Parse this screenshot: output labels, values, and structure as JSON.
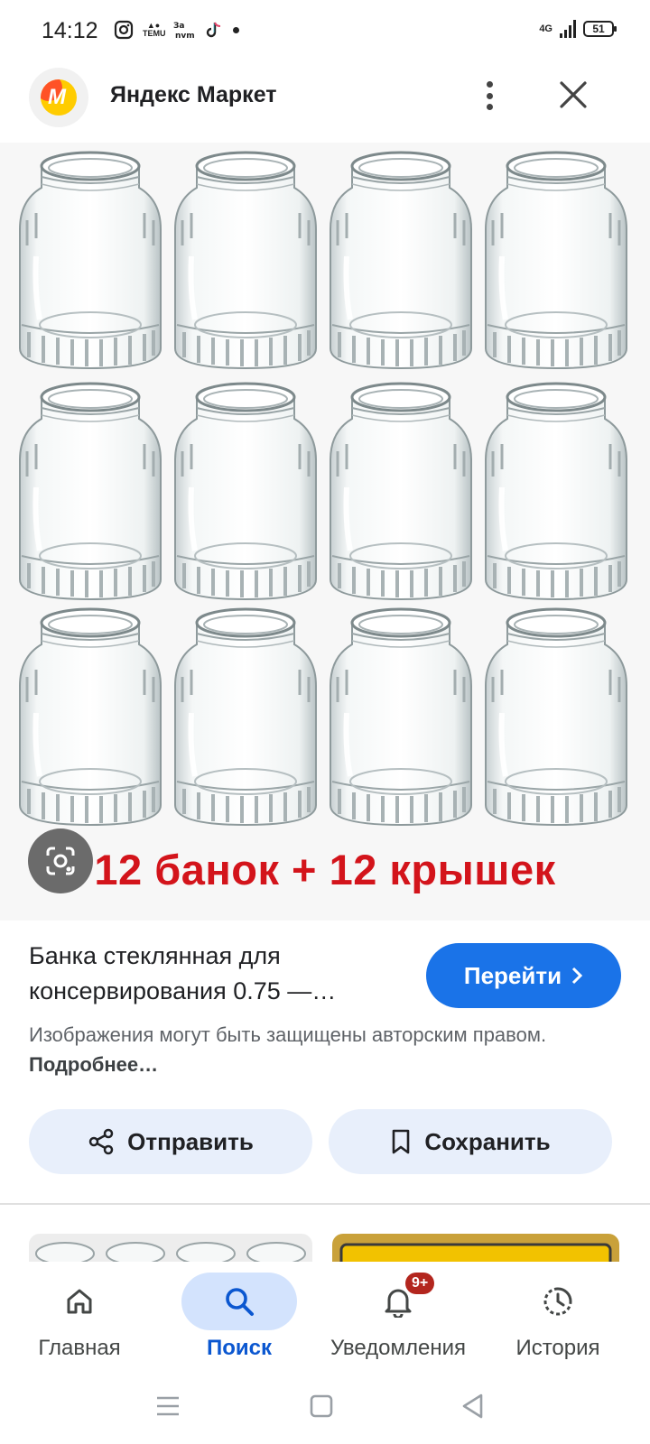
{
  "status_bar": {
    "time": "14:12",
    "apps": [
      "instagram-icon",
      "temu-icon",
      "zapravda-icon",
      "tiktok-icon"
    ],
    "temu_label": "TEMU",
    "network": "4G",
    "battery": "51"
  },
  "header": {
    "title": "Яндекс Маркет"
  },
  "image": {
    "caption": "12 банок + 12 крышек"
  },
  "result": {
    "title": "Банка стеклянная для консервирования 0.75 —…",
    "visit_label": "Перейти",
    "copyright_text": "Изображения могут быть защищены авторским правом.",
    "more_label": "Подробнее…"
  },
  "actions": {
    "share_label": "Отправить",
    "save_label": "Сохранить"
  },
  "bottom_nav": {
    "items": [
      {
        "label": "Главная",
        "icon": "home-icon"
      },
      {
        "label": "Поиск",
        "icon": "search-icon"
      },
      {
        "label": "Уведомления",
        "icon": "bell-icon",
        "badge": "9+"
      },
      {
        "label": "История",
        "icon": "history-icon"
      }
    ],
    "active": "Поиск"
  },
  "colors": {
    "accent": "#1a73e8",
    "caption_red": "#d3141b",
    "chip_bg": "#e8effb"
  }
}
